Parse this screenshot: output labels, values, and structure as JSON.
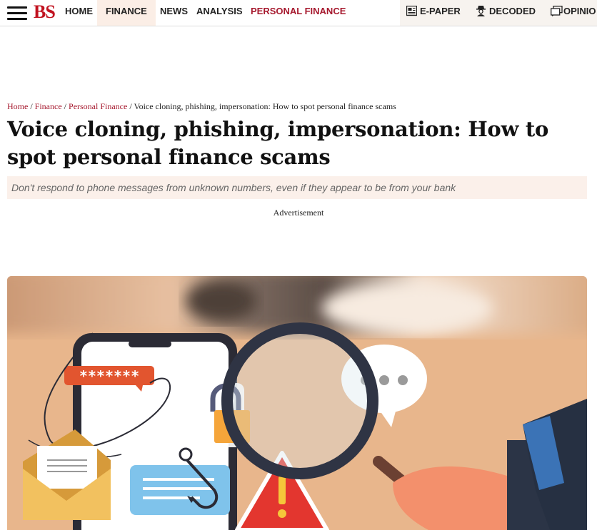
{
  "header": {
    "logo": "BS",
    "nav": [
      {
        "label": "HOME",
        "active": false
      },
      {
        "label": "FINANCE",
        "active": true
      },
      {
        "label": "NEWS",
        "active": false
      },
      {
        "label": "ANALYSIS",
        "active": false
      },
      {
        "label": "PERSONAL FINANCE",
        "active": false
      }
    ],
    "utility": [
      {
        "label": "E-PAPER",
        "icon": "newspaper-icon"
      },
      {
        "label": "DECODED",
        "icon": "detective-icon"
      },
      {
        "label": "OPINIO",
        "icon": "opinion-icon"
      }
    ]
  },
  "breadcrumb": {
    "home": "Home",
    "finance": "Finance",
    "personal_finance": "Personal Finance",
    "separator": " / ",
    "current": "Voice cloning, phishing, impersonation: How to spot personal finance scams"
  },
  "article": {
    "title": "Voice cloning, phishing, impersonation: How to spot personal finance scams",
    "subtitle": "Don't respond to phone messages from unknown numbers, even if they appear to be from your bank",
    "ad_label": "Advertisement",
    "hero": {
      "password_text": "*******",
      "icons": [
        "phone-icon",
        "padlock-icon",
        "warning-icon",
        "fishing-hook-icon",
        "envelope-icon",
        "chat-bubble-icon",
        "magnifying-glass-icon",
        "hand-icon"
      ]
    }
  },
  "colors": {
    "brand_red": "#c1121f",
    "link_red": "#a6192e",
    "active_tab_bg": "#fbeee6",
    "subtitle_bg": "#fbf0ea",
    "hero_bg": "#e9b88f"
  }
}
